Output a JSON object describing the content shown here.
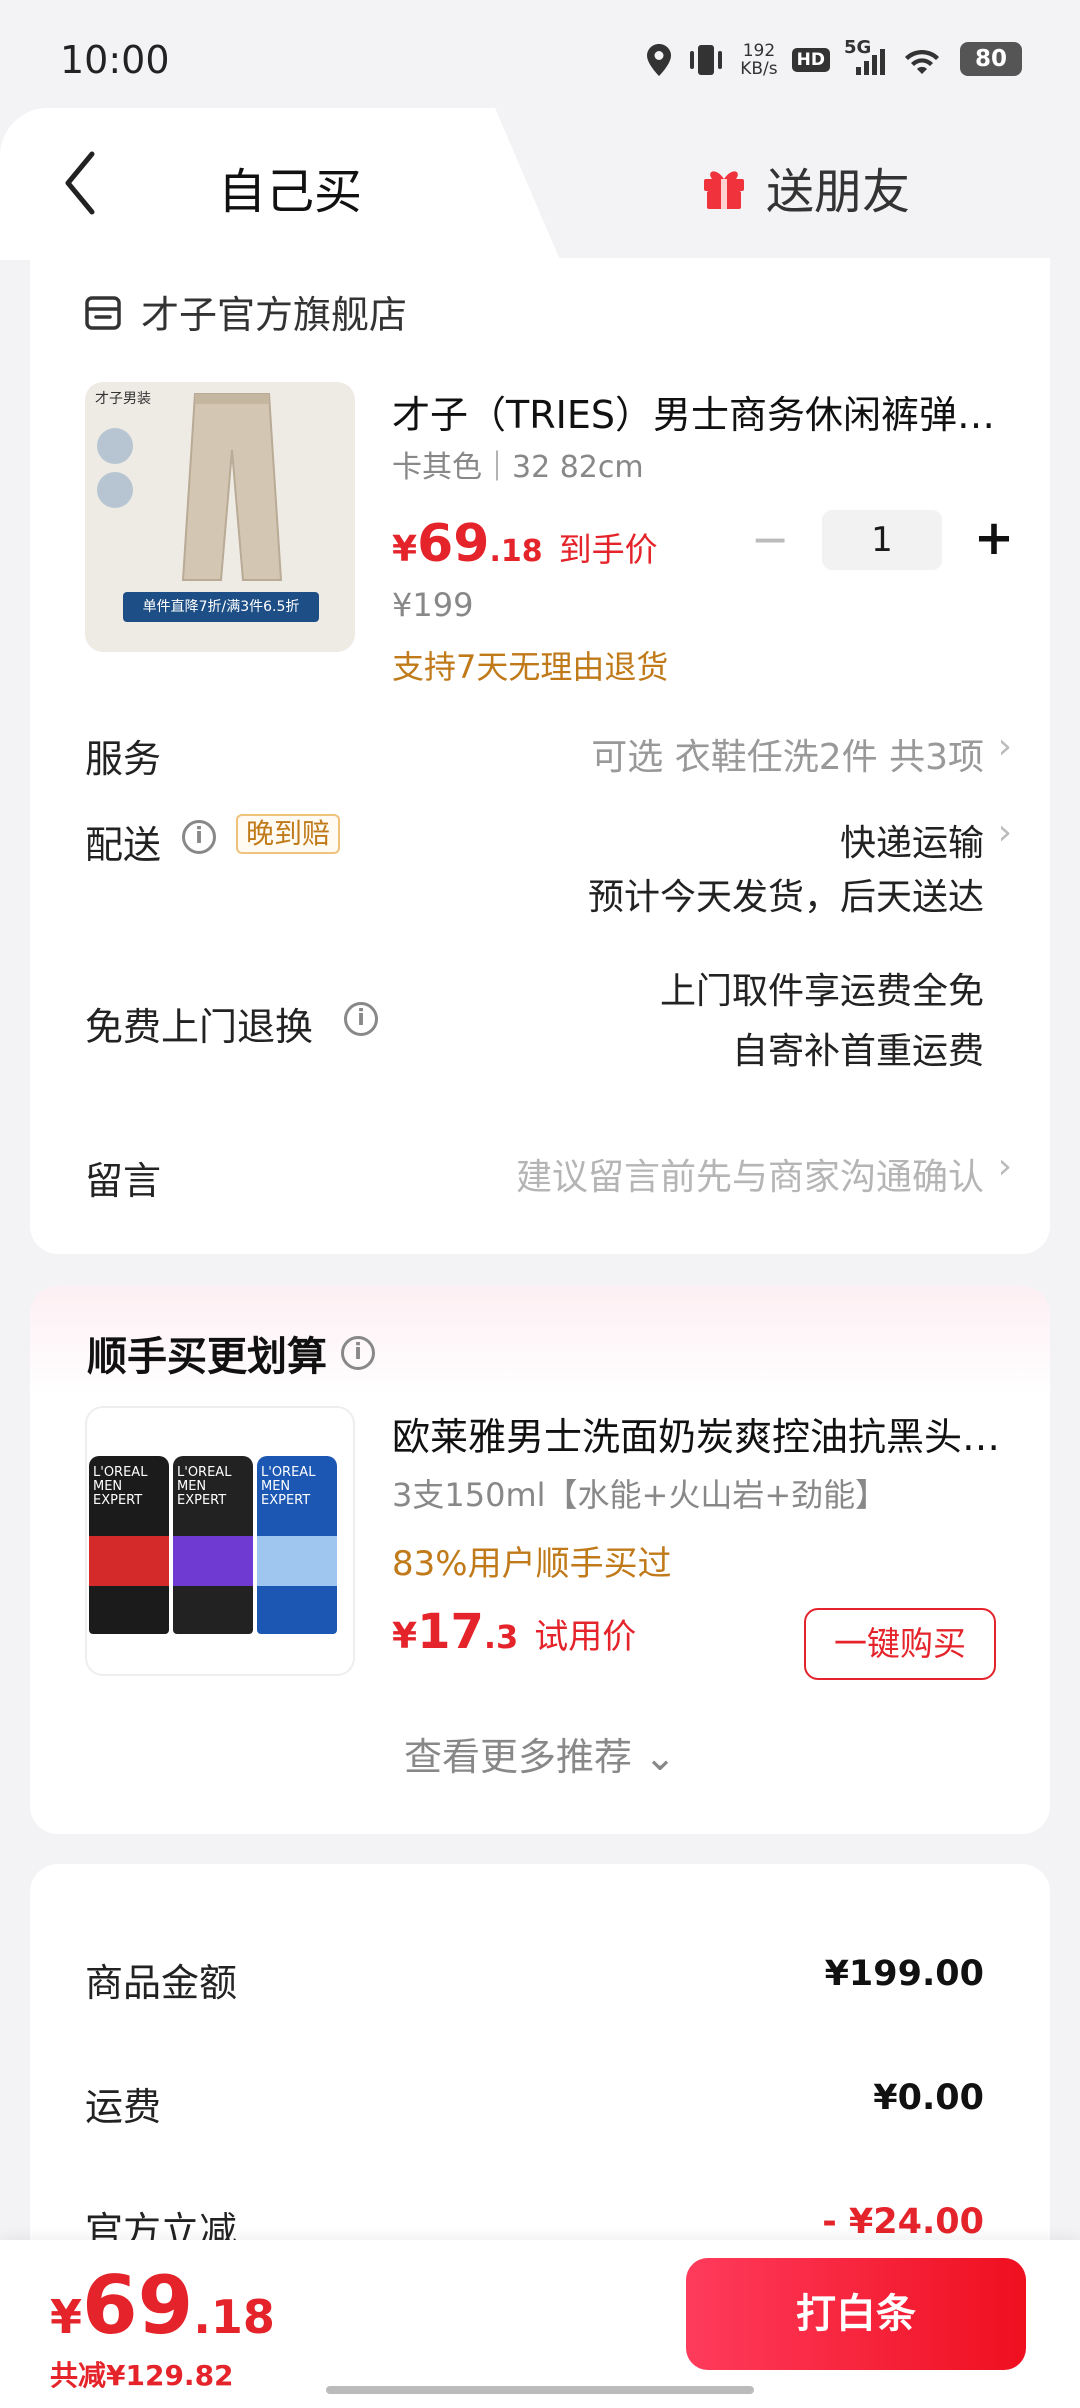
{
  "status_bar": {
    "time": "10:00",
    "net_speed_value": "192",
    "net_speed_unit": "KB/s",
    "hd": "HD",
    "network": "5G",
    "battery": "80",
    "icons": [
      "location-icon",
      "vibrate-icon",
      "signal-icon",
      "wifi-icon",
      "battery-icon"
    ]
  },
  "header": {
    "tab_self": "自己买",
    "tab_gift": "送朋友"
  },
  "store": {
    "name": "才子官方旗舰店"
  },
  "product": {
    "image_logo": "才子男装",
    "image_promo": "单件直降7折/满3件6.5折",
    "title": "才子（TRIES）男士商务休闲裤弹力直筒西裤",
    "spec": "卡其色｜32 82cm",
    "price_yen": "¥",
    "price_int": "69",
    "price_dec": ".18",
    "price_tag": "到手价",
    "original_price": "¥199",
    "return_note": "支持7天无理由退货",
    "quantity": "1",
    "minus": "−",
    "plus": "+"
  },
  "rows": {
    "service_label": "服务",
    "service_value": "可选 衣鞋任洗2件 共3项",
    "delivery_label": "配送",
    "delivery_badge": "晚到赔",
    "delivery_method": "快递运输",
    "delivery_eta": "预计今天发货，后天送达",
    "return_label": "免费上门退换",
    "return_line1": "上门取件享运费全免",
    "return_line2": "自寄补首重运费",
    "message_label": "留言",
    "message_placeholder": "建议留言前先与商家沟通确认",
    "chevron": "›",
    "info": "i"
  },
  "recommend": {
    "title": "顺手买更划算",
    "name": "欧莱雅男士洗面奶炭爽控油抗黑头洁面膏",
    "spec": "3支150ml【水能+火山岩+劲能】",
    "stat": "83%用户顺手买过",
    "price_yen": "¥",
    "price_int": "17",
    "price_dec": ".3",
    "price_tag": "试用价",
    "buy_button": "一键购买",
    "more": "查看更多推荐 ⌄",
    "tube_brand": "L'OREAL MEN EXPERT"
  },
  "summary": {
    "goods_label": "商品金额",
    "goods_value": "¥199.00",
    "shipping_label": "运费",
    "shipping_value": "¥0.00",
    "discount_label": "官方立减",
    "discount_value": "- ¥24.00"
  },
  "bottom": {
    "total_yen": "¥",
    "total_int": "69",
    "total_dec": ".18",
    "saved": "共减¥129.82",
    "pay_button": "打白条"
  },
  "colors": {
    "accent_red": "#e4242a",
    "note_orange": "#c07a1a"
  }
}
